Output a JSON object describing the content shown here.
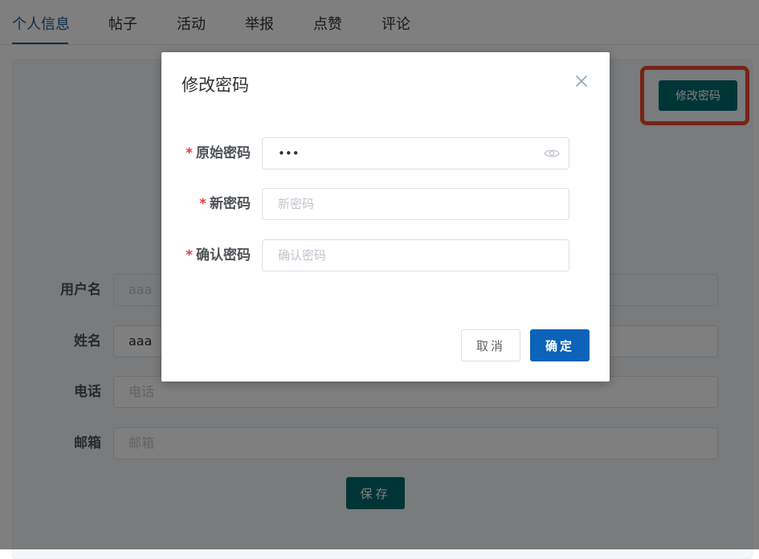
{
  "tabs": [
    {
      "label": "个人信息",
      "active": true
    },
    {
      "label": "帖子"
    },
    {
      "label": "活动"
    },
    {
      "label": "举报"
    },
    {
      "label": "点赞"
    },
    {
      "label": "评论"
    }
  ],
  "profile": {
    "change_password_button": "修改密码",
    "fields": {
      "username": {
        "label": "用户名",
        "value": "aaa"
      },
      "name": {
        "label": "姓名",
        "value": "aaa"
      },
      "phone": {
        "label": "电话",
        "placeholder": "电话"
      },
      "email": {
        "label": "邮箱",
        "placeholder": "邮箱"
      }
    },
    "save_button": "保存"
  },
  "dialog": {
    "title": "修改密码",
    "fields": {
      "old_password": {
        "label": "原始密码",
        "value": "•••",
        "required": true
      },
      "new_password": {
        "label": "新密码",
        "placeholder": "新密码",
        "required": true
      },
      "confirm_password": {
        "label": "确认密码",
        "placeholder": "确认密码",
        "required": true
      }
    },
    "cancel_button": "取消",
    "ok_button": "确定",
    "required_mark": "*"
  },
  "colors": {
    "primary": "#0d62b9",
    "teal": "#006a6e",
    "highlight": "#ee4a2a",
    "tab_active": "#1a5c92"
  },
  "icons": {
    "close": "close-icon",
    "eye": "eye-icon"
  }
}
